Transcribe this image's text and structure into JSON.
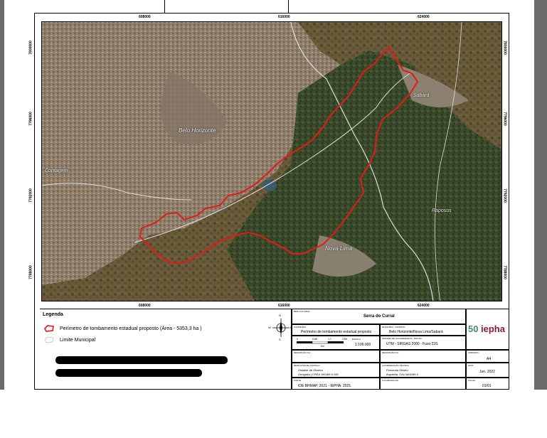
{
  "map": {
    "top_ticks": [
      "608000",
      "616000",
      "624000"
    ],
    "bottom_ticks": [
      "608000",
      "616000",
      "624000"
    ],
    "left_ticks": [
      "7800000",
      "7796000",
      "7792000",
      "7788000"
    ],
    "right_ticks": [
      "7800000",
      "7796000",
      "7792000",
      "7788000"
    ],
    "place_labels": {
      "belo_horizonte": "Belo Horizonte",
      "contagem": "Contagem",
      "sabara": "Sabará",
      "raposos": "Raposos",
      "nova_lima": "Nova Lima"
    }
  },
  "legend": {
    "title": "Legenda",
    "items": [
      {
        "label": "Perímetro de tombamento estadual proposto (Área - 5353,3 ha )",
        "color": "#e31a1c"
      },
      {
        "label": "Limite Municipal",
        "color": "#dddddd"
      }
    ]
  },
  "titleblock": {
    "caption_main": "BEM CULTURAL",
    "name": "Serra do Curral",
    "caption_content": "CONTEÚDO",
    "content": "Perímetro de tombamento estadual proposto",
    "caption_municipality": "MUNICÍPIO - DISTRITO",
    "municipality": "Belo Horizonte/Nova Lima/Sabará",
    "caption_system": "SISTEMA DE COORDENADAS - DATUM",
    "system": "UTM - SIRGAS 2000 - Fuso 23S",
    "scale_caption": "ESCALA",
    "scale": "1:106.000",
    "scalebar_labels": [
      "0",
      "0,85",
      "1,7",
      "2,55"
    ],
    "scalebar_unit": "km",
    "caption_folha": "FORMATO",
    "folha": "A4",
    "caption_resp": "RESPONSÁVEL TÉCNICO",
    "resp_name": "Gislaine de Oliveira",
    "resp_detail": "Geógrafa | CREA 190489 D MG",
    "caption_coord": "COORDENAÇÃO TÉCNICA",
    "coord_name": "Fernanda Shiotto",
    "coord_detail": "Arquiteta, CAU A63289-9",
    "caption_date": "DATA",
    "date": "Jun. 2022",
    "caption_source": "FONTE",
    "source": "IDE BHMAP, 2021 - IEPHA, 2021.",
    "caption_collab": "COLABORAÇÃO",
    "caption_page": "FOLHA",
    "page": "01/01",
    "caption_desc1": "DESCRIÇÃO N.1",
    "caption_desc2": "DESCRIÇÃO N.2",
    "logo_num": "50",
    "logo_text": "iepha",
    "compass_n": "N",
    "compass_s": "S",
    "compass_e": "E",
    "compass_w": "W"
  },
  "colors": {
    "boundary_red": "#e31a1c",
    "municipal_line": "#dddddd",
    "iepha_brand": "#8a1a3a",
    "iepha_green": "#4b8a6a"
  }
}
